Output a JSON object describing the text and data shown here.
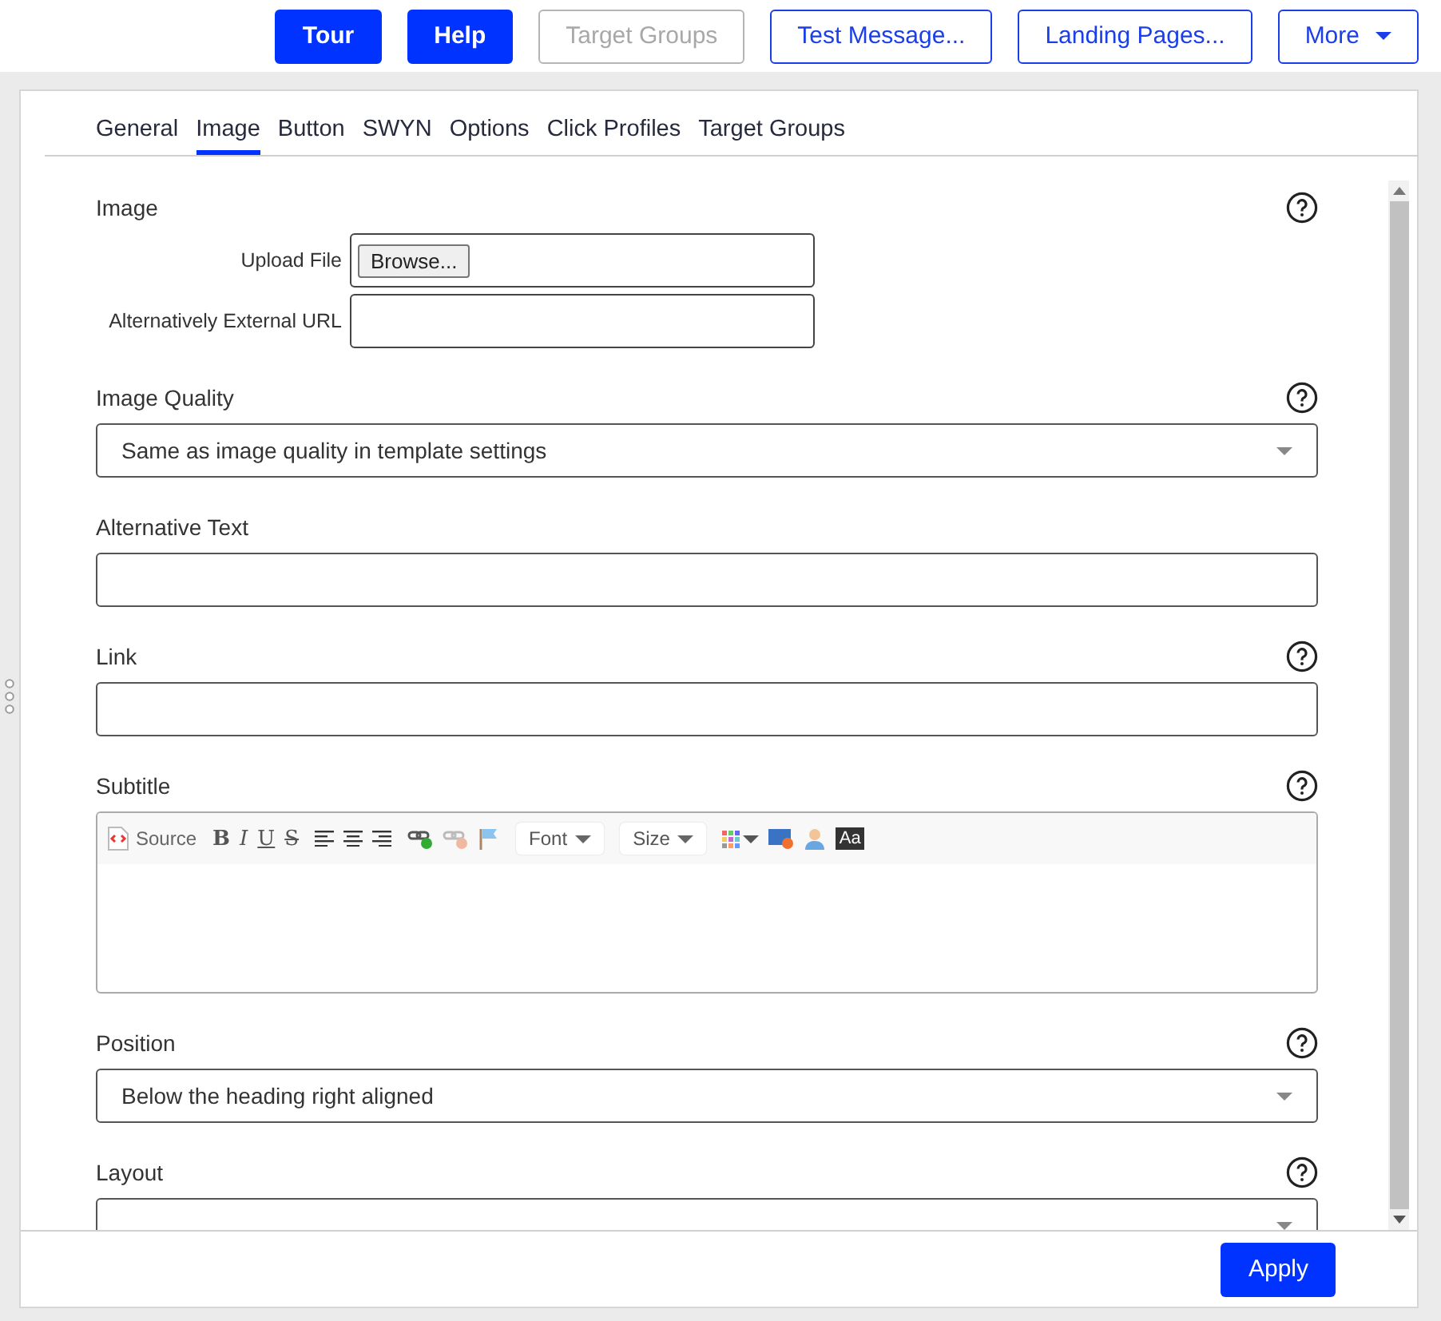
{
  "top_buttons": [
    {
      "label": "Tour",
      "kind": "primary"
    },
    {
      "label": "Help",
      "kind": "primary"
    },
    {
      "label": "Target Groups",
      "kind": "disabled"
    },
    {
      "label": "Test Message...",
      "kind": "outline"
    },
    {
      "label": "Landing Pages...",
      "kind": "outline"
    },
    {
      "label": "More",
      "kind": "dropdown"
    }
  ],
  "tabs": [
    {
      "label": "General",
      "selected": false
    },
    {
      "label": "Image",
      "selected": true
    },
    {
      "label": "Button",
      "selected": false
    },
    {
      "label": "SWYN",
      "selected": false
    },
    {
      "label": "Options",
      "selected": false
    },
    {
      "label": "Click Profiles",
      "selected": false
    },
    {
      "label": "Target Groups",
      "selected": false
    }
  ],
  "sections": [
    {
      "kind": "upload",
      "label": "Image",
      "help": true,
      "upload_label": "Upload File",
      "browse": "Browse...",
      "url_label": "Alternatively External URL"
    },
    {
      "kind": "select",
      "label": "Image Quality",
      "help": true,
      "value": "Same as image quality in template settings"
    },
    {
      "kind": "text",
      "label": "Alternative Text"
    },
    {
      "kind": "text",
      "label": "Link",
      "help": true
    },
    {
      "kind": "editor",
      "label": "Subtitle",
      "help": true,
      "toolbar": [
        [
          {
            "kind": "source",
            "label": "Source"
          }
        ],
        [
          {
            "kind": "bold",
            "label": "B"
          },
          {
            "kind": "italic",
            "label": "I"
          },
          {
            "kind": "underline",
            "label": "U"
          },
          {
            "kind": "strike",
            "label": "S"
          }
        ],
        [
          {
            "kind": "align-left"
          },
          {
            "kind": "align-center"
          },
          {
            "kind": "align-right"
          }
        ],
        [
          {
            "kind": "link"
          },
          {
            "kind": "unlink"
          },
          {
            "kind": "anchor"
          }
        ],
        [
          {
            "kind": "combo",
            "label": "Font"
          }
        ],
        [
          {
            "kind": "combo",
            "label": "Size"
          }
        ],
        [
          {
            "kind": "colors"
          },
          {
            "kind": "html"
          },
          {
            "kind": "person"
          },
          {
            "kind": "textcase",
            "label": "Aa"
          }
        ]
      ]
    },
    {
      "kind": "select",
      "label": "Position",
      "help": true,
      "value": "Below the heading right aligned"
    },
    {
      "kind": "select",
      "label": "Layout",
      "help": true
    }
  ],
  "apply": "Apply"
}
